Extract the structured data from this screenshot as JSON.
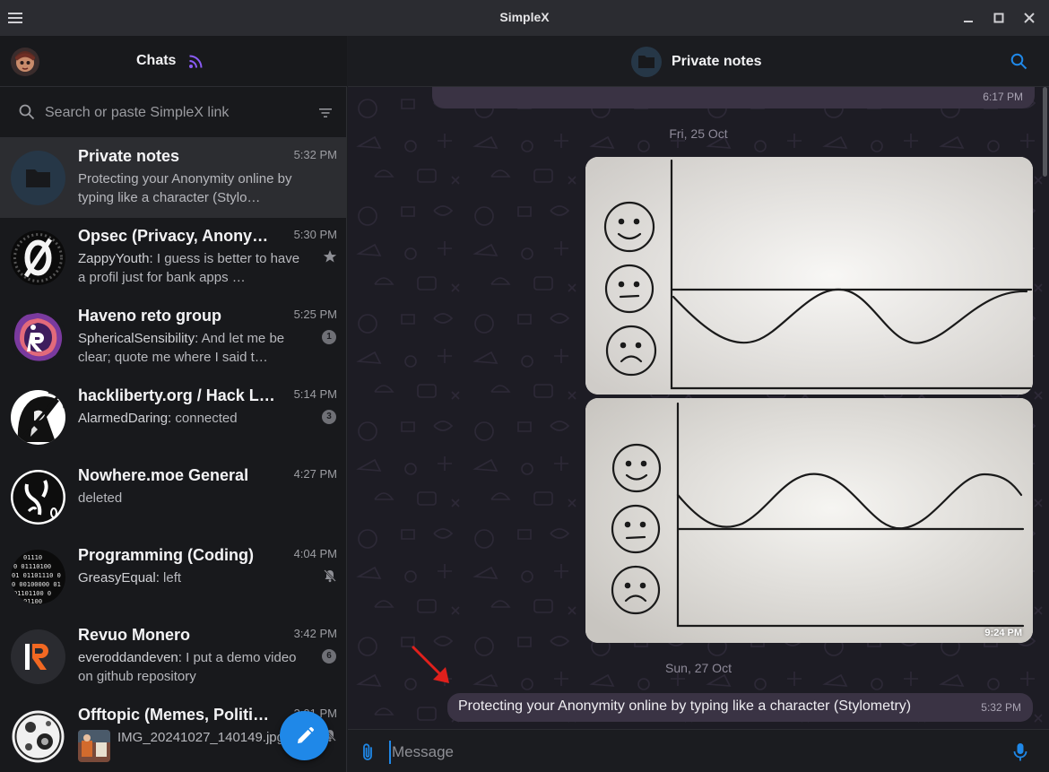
{
  "window": {
    "title": "SimpleX"
  },
  "sidebar": {
    "title": "Chats",
    "search_placeholder": "Search or paste SimpleX link",
    "chats": [
      {
        "name": "Private notes",
        "time": "5:32 PM",
        "sender": "",
        "preview": "Protecting your Anonymity online by typing like a character (Stylo…",
        "active": true
      },
      {
        "name": "Opsec (Privacy, Anony…",
        "time": "5:30 PM",
        "sender": "ZappyYouth:",
        "preview": " I guess is better to have a profil just for bank apps …",
        "icon": "star-icon"
      },
      {
        "name": "Haveno reto group",
        "time": "5:25 PM",
        "sender": "SphericalSensibility:",
        "preview": " And let me be clear; quote me where I said t…",
        "badge": "1"
      },
      {
        "name": "hackliberty.org / Hack L…",
        "time": "5:14 PM",
        "sender": "AlarmedDaring:",
        "preview": " connected",
        "badge": "3"
      },
      {
        "name": "Nowhere.moe General",
        "time": "4:27 PM",
        "sender": "",
        "preview": "deleted"
      },
      {
        "name": "Programming (Coding)",
        "time": "4:04 PM",
        "sender": "GreasyEqual:",
        "preview": " left",
        "icon": "muted-bell-icon"
      },
      {
        "name": "Revuo Monero",
        "time": "3:42 PM",
        "sender": "everoddandeven:",
        "preview": " I put a demo video on github repository",
        "badge": "6"
      },
      {
        "name": "Offtopic (Memes, Politi…",
        "time": "3:01 PM",
        "sender": "",
        "preview": "IMG_20241027_140149.jpg",
        "icon": "muted-bell-icon"
      }
    ]
  },
  "conversation": {
    "title": "Private notes",
    "top_time": "6:17 PM",
    "day1": "Fri, 25 Oct",
    "image2_time": "9:24 PM",
    "day2": "Sun, 27 Oct",
    "last_message": "Protecting your Anonymity online by typing like a character (Stylometry)",
    "last_time": "5:32 PM",
    "composer_placeholder": "Message"
  },
  "colors": {
    "accent": "#1f88e8",
    "bubble": "#3a3344",
    "sidebar_bg": "#18191c",
    "active_row": "#2c2d31",
    "rss": "#8a5cf6",
    "arrow": "#e0201c"
  }
}
